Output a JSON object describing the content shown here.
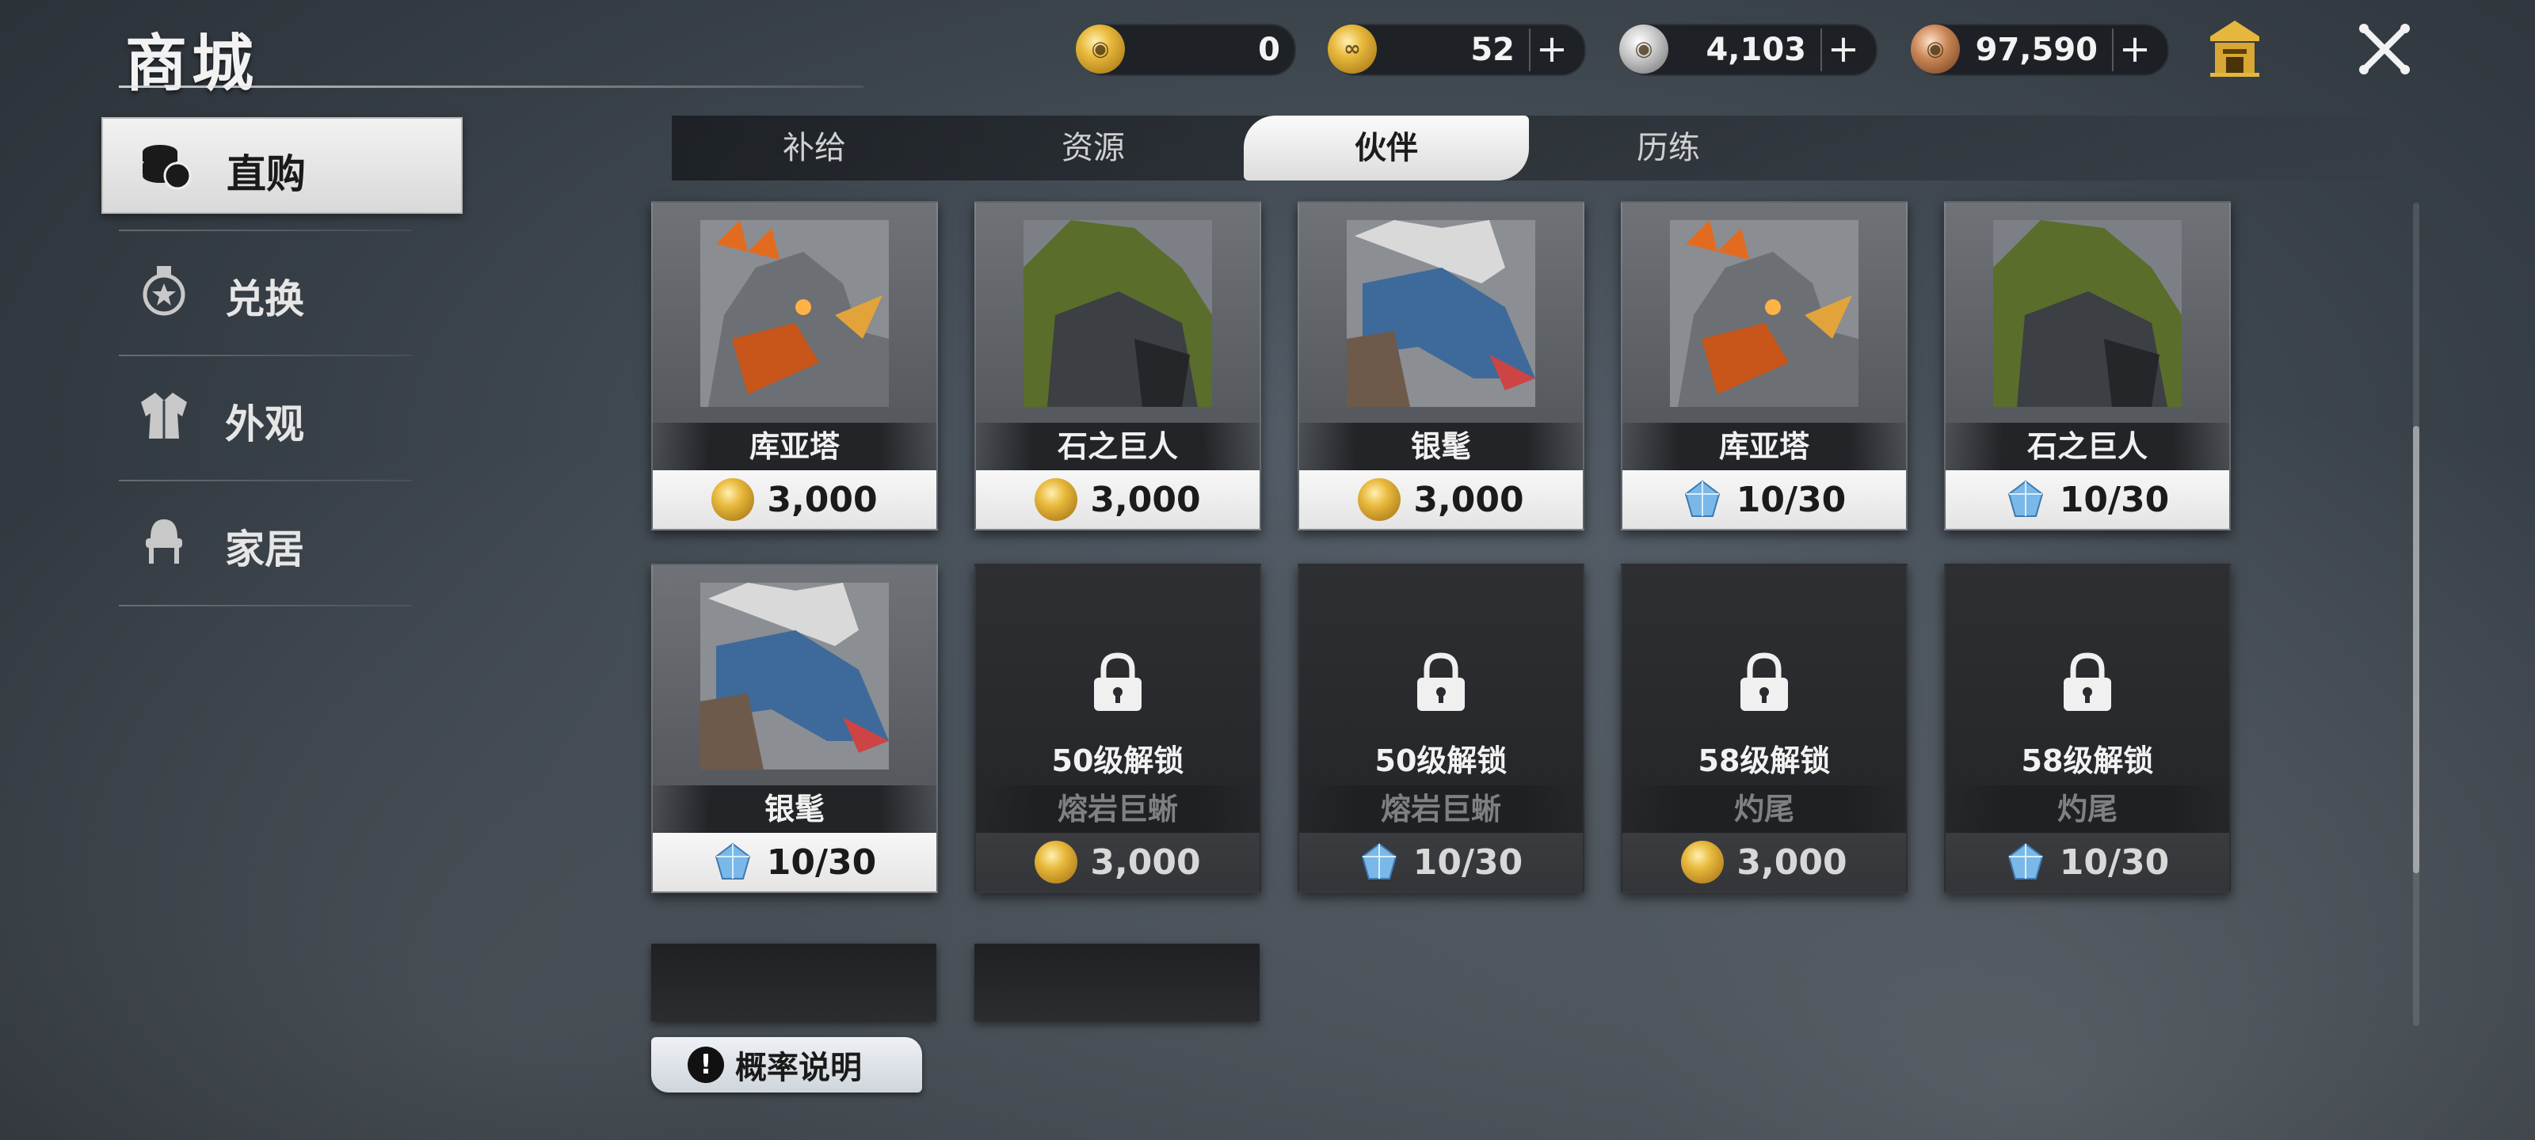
{
  "header": {
    "title": "商城"
  },
  "currencies": [
    {
      "icon": "gold-coin-icon",
      "amount": "0",
      "has_plus": false
    },
    {
      "icon": "bound-gold-coin-icon",
      "amount": "52",
      "has_plus": true
    },
    {
      "icon": "silver-coin-icon",
      "amount": "4,103",
      "has_plus": true
    },
    {
      "icon": "bronze-coin-icon",
      "amount": "97,590",
      "has_plus": true
    }
  ],
  "sidebar": {
    "items": [
      {
        "label": "直购",
        "icon": "coins-stack-icon",
        "active": true
      },
      {
        "label": "兑换",
        "icon": "medal-icon",
        "active": false
      },
      {
        "label": "外观",
        "icon": "outfit-icon",
        "active": false
      },
      {
        "label": "家居",
        "icon": "chair-icon",
        "active": false
      }
    ]
  },
  "tabs": [
    {
      "label": "补给",
      "active": false
    },
    {
      "label": "资源",
      "active": false
    },
    {
      "label": "伙伴",
      "active": true
    },
    {
      "label": "历练",
      "active": false
    }
  ],
  "cards": [
    {
      "name": "库亚塔",
      "price": "3,000",
      "currency": "gold-coin-icon",
      "locked": false,
      "lock_text": ""
    },
    {
      "name": "石之巨人",
      "price": "3,000",
      "currency": "gold-coin-icon",
      "locked": false,
      "lock_text": ""
    },
    {
      "name": "银髦",
      "price": "3,000",
      "currency": "gold-coin-icon",
      "locked": false,
      "lock_text": ""
    },
    {
      "name": "库亚塔",
      "price": "10/30",
      "currency": "crystal-icon",
      "locked": false,
      "lock_text": ""
    },
    {
      "name": "石之巨人",
      "price": "10/30",
      "currency": "crystal-icon",
      "locked": false,
      "lock_text": ""
    },
    {
      "name": "银髦",
      "price": "10/30",
      "currency": "crystal-icon",
      "locked": false,
      "lock_text": ""
    },
    {
      "name": "熔岩巨蜥",
      "price": "3,000",
      "currency": "gold-coin-icon",
      "locked": true,
      "lock_text": "50级解锁"
    },
    {
      "name": "熔岩巨蜥",
      "price": "10/30",
      "currency": "crystal-icon",
      "locked": true,
      "lock_text": "50级解锁"
    },
    {
      "name": "灼尾",
      "price": "3,000",
      "currency": "gold-coin-icon",
      "locked": true,
      "lock_text": "58级解锁"
    },
    {
      "name": "灼尾",
      "price": "10/30",
      "currency": "crystal-icon",
      "locked": true,
      "lock_text": "58级解锁"
    }
  ],
  "footer": {
    "probability_label": "概率说明"
  },
  "colors": {
    "accent_light": "#e6e6e6",
    "gold": "#e8b93c",
    "crystal": "#7ab8e8",
    "locked_card": "#2d2f32"
  }
}
